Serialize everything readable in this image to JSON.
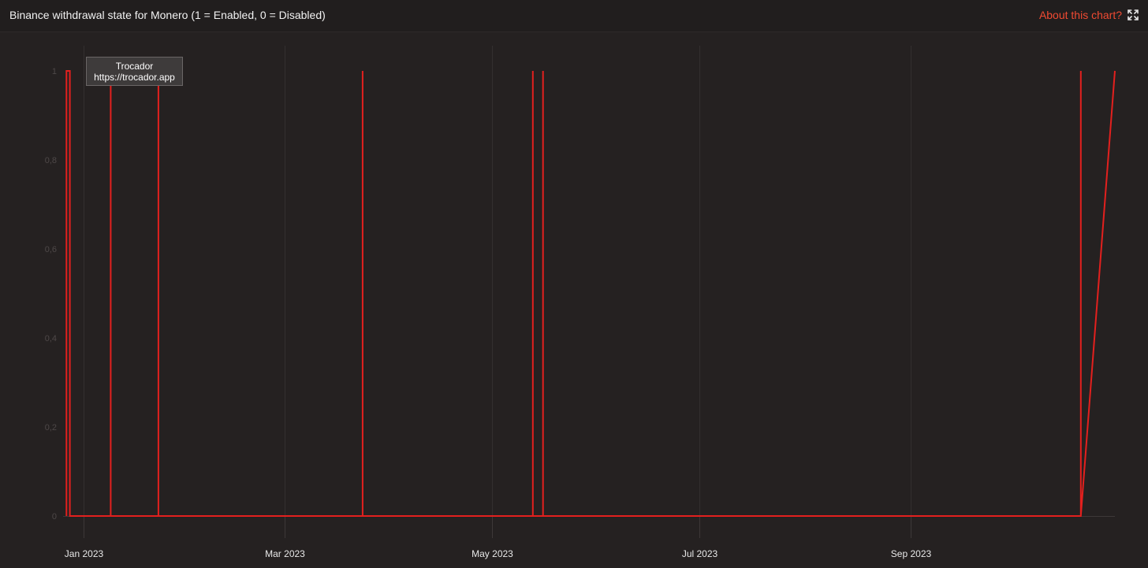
{
  "header": {
    "title": "Binance withdrawal state for Monero (1 = Enabled, 0 = Disabled)",
    "about_label": "About this chart?",
    "fullscreen_icon": "expand-icon"
  },
  "tooltip": {
    "line1": "Trocador",
    "line2": "https://trocador.app"
  },
  "colors": {
    "background": "#252121",
    "line": "#e3201e",
    "grid": "#332f2f",
    "accent": "#f04a32"
  },
  "chart_data": {
    "type": "line",
    "step": true,
    "title": "Binance withdrawal state for Monero (1 = Enabled, 0 = Disabled)",
    "xlabel": "",
    "ylabel": "",
    "ylim": [
      0,
      1
    ],
    "xlim": [
      "2022-12-26",
      "2023-10-31"
    ],
    "y_ticks": [
      "0",
      "0,2",
      "0,4",
      "0,6",
      "0,8",
      "1"
    ],
    "x_ticks": [
      {
        "date": "2023-01-01",
        "label": "Jan 2023"
      },
      {
        "date": "2023-03-01",
        "label": "Mar 2023"
      },
      {
        "date": "2023-05-01",
        "label": "May 2023"
      },
      {
        "date": "2023-07-01",
        "label": "Jul 2023"
      },
      {
        "date": "2023-09-01",
        "label": "Sep 2023"
      }
    ],
    "grid": true,
    "series": [
      {
        "name": "",
        "x": [
          "2022-12-27",
          "2022-12-27",
          "2022-12-28",
          "2022-12-28",
          "2023-01-09",
          "2023-01-09",
          "2023-01-09",
          "2023-01-09",
          "2023-01-23",
          "2023-01-23",
          "2023-01-23",
          "2023-01-23",
          "2023-03-24",
          "2023-03-24",
          "2023-03-24",
          "2023-03-24",
          "2023-05-13",
          "2023-05-13",
          "2023-05-13",
          "2023-05-13",
          "2023-05-16",
          "2023-05-16",
          "2023-05-16",
          "2023-05-16",
          "2023-10-21",
          "2023-10-21",
          "2023-10-21",
          "2023-10-21",
          "2023-10-31"
        ],
        "y": [
          0,
          1,
          1,
          0,
          0,
          1,
          1,
          0,
          0,
          1,
          1,
          0,
          0,
          1,
          1,
          0,
          0,
          1,
          1,
          0,
          0,
          1,
          1,
          0,
          0,
          1,
          1,
          0,
          1
        ]
      }
    ]
  }
}
